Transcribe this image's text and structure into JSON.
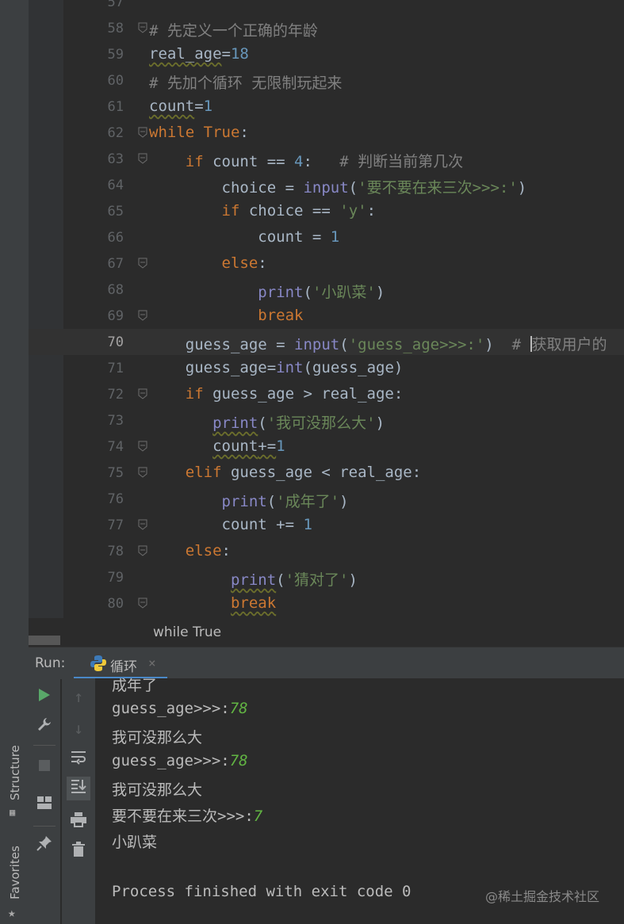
{
  "editor": {
    "lines": [
      {
        "n": "57",
        "tokens": []
      },
      {
        "n": "58",
        "tokens": [
          {
            "t": "# 先定义一个正确的年龄",
            "c": "cmt"
          }
        ]
      },
      {
        "n": "59",
        "tokens": [
          {
            "t": "real_age",
            "c": "sq"
          },
          {
            "t": "=",
            "c": ""
          },
          {
            "t": "18",
            "c": "num"
          }
        ]
      },
      {
        "n": "60",
        "tokens": [
          {
            "t": "# 先加个循环 无限制玩起来",
            "c": "cmt"
          }
        ]
      },
      {
        "n": "61",
        "tokens": [
          {
            "t": "count",
            "c": "sq"
          },
          {
            "t": "=",
            "c": ""
          },
          {
            "t": "1",
            "c": "num"
          }
        ]
      },
      {
        "n": "62",
        "tokens": [
          {
            "t": "while True",
            "c": "kw"
          },
          {
            "t": ":",
            "c": ""
          }
        ]
      },
      {
        "n": "63",
        "tokens": [
          {
            "t": "    ",
            "c": ""
          },
          {
            "t": "if",
            "c": "kw"
          },
          {
            "t": " count == ",
            "c": ""
          },
          {
            "t": "4",
            "c": "num"
          },
          {
            "t": ":   ",
            "c": ""
          },
          {
            "t": "# 判断当前第几次",
            "c": "cmt"
          }
        ]
      },
      {
        "n": "64",
        "tokens": [
          {
            "t": "        choice = ",
            "c": ""
          },
          {
            "t": "input",
            "c": "bi"
          },
          {
            "t": "(",
            "c": ""
          },
          {
            "t": "'要不要在来三次>>>:'",
            "c": "str"
          },
          {
            "t": ")",
            "c": ""
          }
        ]
      },
      {
        "n": "65",
        "tokens": [
          {
            "t": "        ",
            "c": ""
          },
          {
            "t": "if",
            "c": "kw"
          },
          {
            "t": " choice == ",
            "c": ""
          },
          {
            "t": "'y'",
            "c": "str"
          },
          {
            "t": ":",
            "c": ""
          }
        ]
      },
      {
        "n": "66",
        "tokens": [
          {
            "t": "            count = ",
            "c": ""
          },
          {
            "t": "1",
            "c": "num"
          }
        ]
      },
      {
        "n": "67",
        "tokens": [
          {
            "t": "        ",
            "c": ""
          },
          {
            "t": "else",
            "c": "kw"
          },
          {
            "t": ":",
            "c": ""
          }
        ]
      },
      {
        "n": "68",
        "tokens": [
          {
            "t": "            ",
            "c": ""
          },
          {
            "t": "print",
            "c": "bi"
          },
          {
            "t": "(",
            "c": ""
          },
          {
            "t": "'小趴菜'",
            "c": "str"
          },
          {
            "t": ")",
            "c": ""
          }
        ]
      },
      {
        "n": "69",
        "tokens": [
          {
            "t": "            ",
            "c": ""
          },
          {
            "t": "break",
            "c": "kw"
          }
        ]
      },
      {
        "n": "70",
        "tokens": [
          {
            "t": "    guess_age = ",
            "c": ""
          },
          {
            "t": "input",
            "c": "bi"
          },
          {
            "t": "(",
            "c": ""
          },
          {
            "t": "'guess_age>>>:'",
            "c": "str"
          },
          {
            "t": ")  ",
            "c": ""
          },
          {
            "t": "# ",
            "c": "cmt"
          },
          {
            "t": "|",
            "c": "caret"
          },
          {
            "t": "获取用户的",
            "c": "cmt"
          }
        ],
        "current": true
      },
      {
        "n": "71",
        "tokens": [
          {
            "t": "    guess_age",
            "c": ""
          },
          {
            "t": "=",
            "c": ""
          },
          {
            "t": "int",
            "c": "bi"
          },
          {
            "t": "(guess_age)",
            "c": ""
          }
        ]
      },
      {
        "n": "72",
        "tokens": [
          {
            "t": "    ",
            "c": ""
          },
          {
            "t": "if",
            "c": "kw"
          },
          {
            "t": " guess_age > real_age:",
            "c": ""
          }
        ]
      },
      {
        "n": "73",
        "tokens": [
          {
            "t": "       ",
            "c": ""
          },
          {
            "t": "print",
            "c": "bi sq"
          },
          {
            "t": "(",
            "c": ""
          },
          {
            "t": "'我可没那么大'",
            "c": "str"
          },
          {
            "t": ")",
            "c": ""
          }
        ]
      },
      {
        "n": "74",
        "tokens": [
          {
            "t": "       ",
            "c": ""
          },
          {
            "t": "count",
            "c": "sq"
          },
          {
            "t": "+=",
            "c": "sq"
          },
          {
            "t": "1",
            "c": "num"
          }
        ]
      },
      {
        "n": "75",
        "tokens": [
          {
            "t": "    ",
            "c": ""
          },
          {
            "t": "elif",
            "c": "kw"
          },
          {
            "t": " guess_age < real_age:",
            "c": ""
          }
        ]
      },
      {
        "n": "76",
        "tokens": [
          {
            "t": "        ",
            "c": ""
          },
          {
            "t": "print",
            "c": "bi"
          },
          {
            "t": "(",
            "c": ""
          },
          {
            "t": "'成年了'",
            "c": "str"
          },
          {
            "t": ")",
            "c": ""
          }
        ]
      },
      {
        "n": "77",
        "tokens": [
          {
            "t": "        count += ",
            "c": ""
          },
          {
            "t": "1",
            "c": "num"
          }
        ]
      },
      {
        "n": "78",
        "tokens": [
          {
            "t": "    ",
            "c": ""
          },
          {
            "t": "else",
            "c": "kw"
          },
          {
            "t": ":",
            "c": ""
          }
        ]
      },
      {
        "n": "79",
        "tokens": [
          {
            "t": "         ",
            "c": ""
          },
          {
            "t": "print",
            "c": "bi sq"
          },
          {
            "t": "(",
            "c": ""
          },
          {
            "t": "'猜对了'",
            "c": "str"
          },
          {
            "t": ")",
            "c": ""
          }
        ]
      },
      {
        "n": "80",
        "tokens": [
          {
            "t": "         ",
            "c": ""
          },
          {
            "t": "break",
            "c": "kw sq"
          }
        ]
      }
    ],
    "breadcrumb": "while True"
  },
  "run": {
    "label": "Run:",
    "tab_title": "循环",
    "tab_close": "×",
    "console": [
      {
        "text": "成年了",
        "input": ""
      },
      {
        "text": "guess_age>>>:",
        "input": "78"
      },
      {
        "text": "我可没那么大",
        "input": ""
      },
      {
        "text": "guess_age>>>:",
        "input": "78"
      },
      {
        "text": "我可没那么大",
        "input": ""
      },
      {
        "text": "要不要在来三次>>>:",
        "input": "7"
      },
      {
        "text": "小趴菜",
        "input": ""
      },
      {
        "text": "",
        "input": ""
      },
      {
        "text": "Process finished with exit code 0",
        "input": ""
      }
    ]
  },
  "side": {
    "structure": "Structure",
    "favorites": "Favorites"
  },
  "watermark": "@稀土掘金技术社区",
  "icons": {
    "rerun": "play-icon",
    "settings": "wrench-icon",
    "stop": "stop-icon",
    "layout": "layout-icon",
    "pin": "pin-icon",
    "up": "arrow-up-icon",
    "down": "arrow-down-icon",
    "wrap": "soft-wrap-icon",
    "scroll": "scroll-to-end-icon",
    "print": "print-icon",
    "trash": "trash-icon"
  },
  "colors": {
    "keyword": "#cc7832",
    "number": "#6897bb",
    "string": "#6a8759",
    "comment": "#808080",
    "builtin": "#8888c6",
    "input": "#62b543"
  }
}
